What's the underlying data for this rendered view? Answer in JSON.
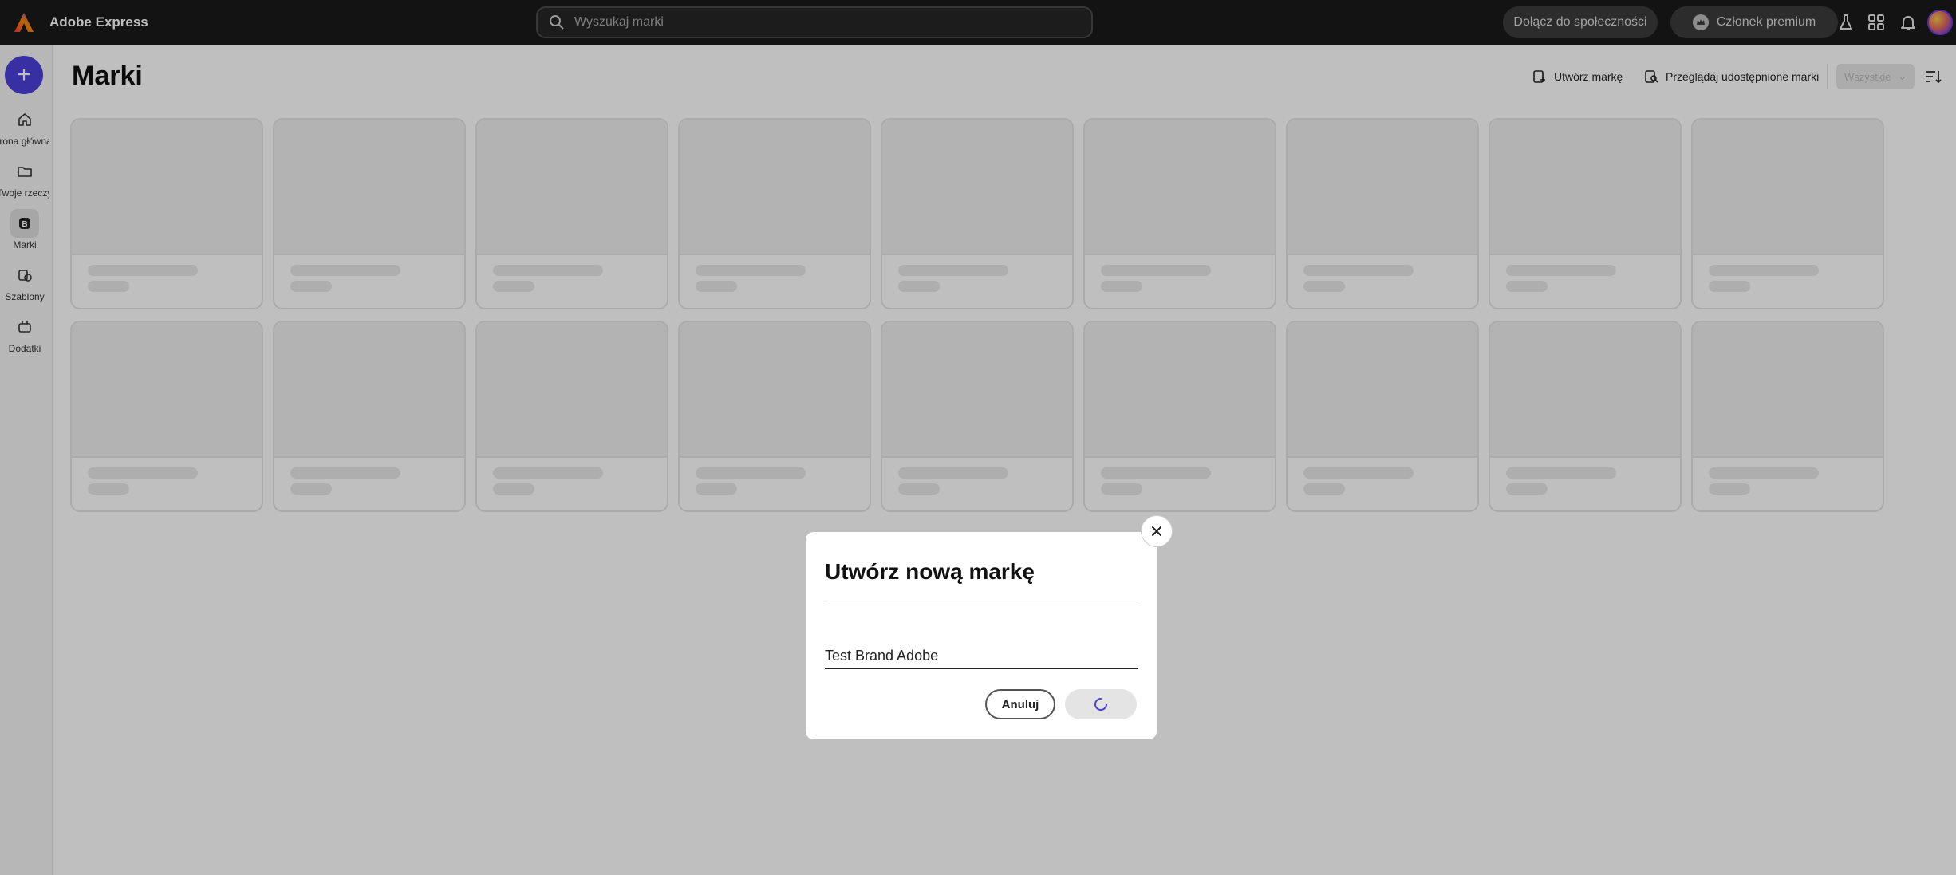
{
  "app": {
    "title": "Adobe Express"
  },
  "search": {
    "placeholder": "Wyszukaj marki"
  },
  "header": {
    "community_label": "Dołącz do społeczności",
    "premium_label": "Członek premium"
  },
  "sidebar": {
    "items": [
      {
        "label": "Strona główna",
        "icon": "home-icon"
      },
      {
        "label": "Twoje rzeczy",
        "icon": "folder-icon"
      },
      {
        "label": "Marki",
        "icon": "brand-icon",
        "active": true
      },
      {
        "label": "Szablony",
        "icon": "templates-icon"
      },
      {
        "label": "Dodatki",
        "icon": "addons-icon"
      }
    ]
  },
  "main": {
    "title": "Marki",
    "create_brand_label": "Utwórz markę",
    "browse_shared_label": "Przeglądaj udostępnione marki",
    "filter_label": "Wszystkie"
  },
  "modal": {
    "title": "Utwórz nową markę",
    "input_value": "Test Brand Adobe",
    "cancel_label": "Anuluj"
  },
  "colors": {
    "accent": "#4b3fd8",
    "topbar": "#1a1a1a"
  }
}
